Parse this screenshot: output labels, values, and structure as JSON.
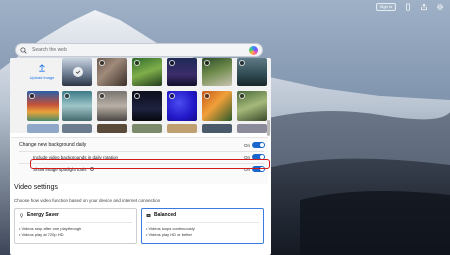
{
  "topbar": {
    "signin_label": "Sign in",
    "icons": [
      "phone-icon",
      "share-icon",
      "gear-icon"
    ]
  },
  "search": {
    "placeholder": "Search the web"
  },
  "gallery": {
    "upload_label": "Upload image"
  },
  "settings": {
    "change_bg_label": "Change new background daily",
    "change_bg_state": "On",
    "include_video_label": "Include video backgrounds in daily rotation",
    "include_video_state": "On",
    "spotlight_label": "Show image spotlight tools",
    "spotlight_state": "On"
  },
  "video_settings": {
    "title": "Video settings",
    "subtitle": "Choose how video function based on your device and internet connection",
    "cards": [
      {
        "title": "Energy Saver",
        "lines": [
          "• Videos stop after one playthrough",
          "• Videos play at 720p HD"
        ],
        "selected": false
      },
      {
        "title": "Balanced",
        "lines": [
          "• Videos loops continuously",
          "• Videos play HD or better"
        ],
        "selected": true
      }
    ]
  },
  "colors": {
    "accent": "#1a66cc",
    "highlight": "#d21b1b"
  }
}
